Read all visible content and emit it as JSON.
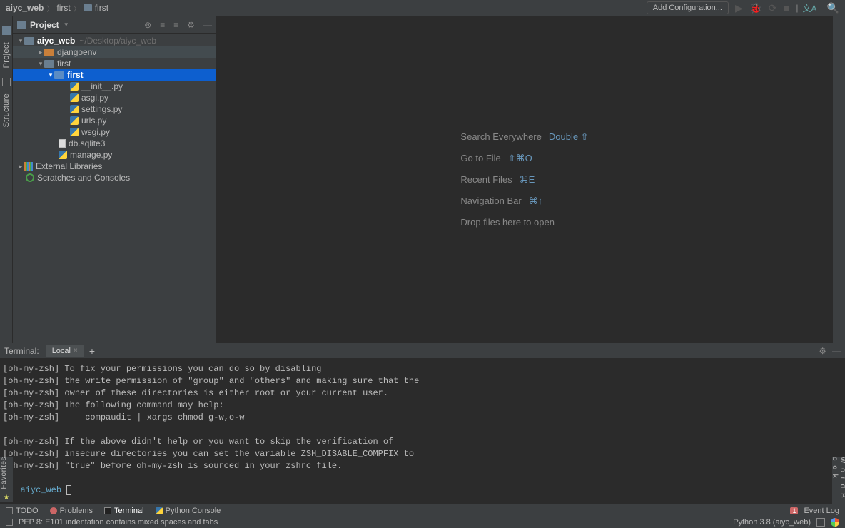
{
  "breadcrumb": {
    "root": "aiyc_web",
    "mid": "first",
    "leaf": "first"
  },
  "navbar": {
    "add_config": "Add Configuration..."
  },
  "project": {
    "header": "Project",
    "root_name": "aiyc_web",
    "root_path": "~/Desktop/aiyc_web",
    "items": {
      "djangoenv": "djangoenv",
      "first": "first",
      "first_inner": "first",
      "init": "__init__.py",
      "asgi": "asgi.py",
      "settings": "settings.py",
      "urls": "urls.py",
      "wsgi": "wsgi.py",
      "db": "db.sqlite3",
      "manage": "manage.py",
      "ext_lib": "External Libraries",
      "scratches": "Scratches and Consoles"
    }
  },
  "hints": {
    "search": {
      "label": "Search Everywhere",
      "key": "Double ⇧"
    },
    "goto": {
      "label": "Go to File",
      "key": "⇧⌘O"
    },
    "recent": {
      "label": "Recent Files",
      "key": "⌘E"
    },
    "navbar": {
      "label": "Navigation Bar",
      "key": "⌘↑"
    },
    "drop": "Drop files here to open"
  },
  "terminal": {
    "title": "Terminal:",
    "tab": "Local",
    "lines": [
      "[oh-my-zsh] To fix your permissions you can do so by disabling",
      "[oh-my-zsh] the write permission of \"group\" and \"others\" and making sure that the",
      "[oh-my-zsh] owner of these directories is either root or your current user.",
      "[oh-my-zsh] The following command may help:",
      "[oh-my-zsh]     compaudit | xargs chmod g-w,o-w",
      "",
      "[oh-my-zsh] If the above didn't help or you want to skip the verification of",
      "[oh-my-zsh] insecure directories you can set the variable ZSH_DISABLE_COMPFIX to",
      "[oh-my-zsh] \"true\" before oh-my-zsh is sourced in your zshrc file."
    ],
    "prompt_dir": "aiyc_web"
  },
  "side": {
    "project": "Project",
    "structure": "Structure",
    "favorites": "Favorites",
    "wordbook": "W o r d B o o k"
  },
  "bottom": {
    "todo": "TODO",
    "problems": "Problems",
    "terminal": "Terminal",
    "pyconsole": "Python Console",
    "event_log": "Event Log",
    "event_badge": "1"
  },
  "status": {
    "msg": "PEP 8: E101 indentation contains mixed spaces and tabs",
    "python": "Python 3.8 (aiyc_web)"
  }
}
